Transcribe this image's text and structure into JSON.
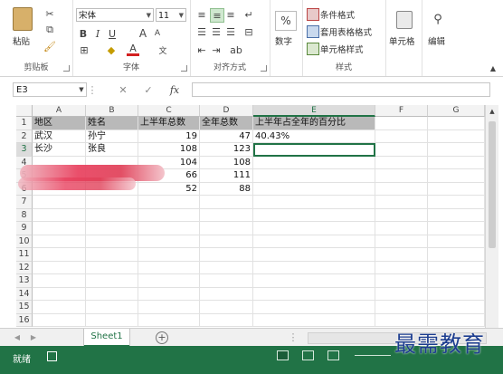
{
  "ribbon": {
    "clipboard": {
      "paste_label": "粘贴",
      "group_label": "剪贴板"
    },
    "font": {
      "name": "宋体",
      "size": "11",
      "bold": "B",
      "italic": "I",
      "underline": "U",
      "grow": "A",
      "shrink": "A",
      "font_color_glyph": "A",
      "group_label": "字体"
    },
    "alignment": {
      "group_label": "对齐方式"
    },
    "number": {
      "percent": "%",
      "label": "数字"
    },
    "styles": {
      "conditional": "条件格式",
      "table": "套用表格格式",
      "cell_styles": "单元格样式",
      "group_label": "样式"
    },
    "cells": {
      "label": "单元格"
    },
    "editing": {
      "label": "编辑"
    }
  },
  "formula_bar": {
    "name_box": "E3",
    "cancel": "✕",
    "enter": "✓",
    "fx": "fx",
    "value": ""
  },
  "columns": [
    "A",
    "B",
    "C",
    "D",
    "E",
    "F",
    "G"
  ],
  "rows": [
    "1",
    "2",
    "3",
    "4",
    "5",
    "6",
    "7",
    "8",
    "9",
    "10",
    "11",
    "12",
    "13",
    "14",
    "15",
    "16"
  ],
  "table": {
    "headers": [
      "地区",
      "姓名",
      "上半年总数",
      "全年总数",
      "上半年占全年的百分比"
    ],
    "data": [
      [
        "武汉",
        "孙宁",
        "19",
        "47",
        "40.43%"
      ],
      [
        "长沙",
        "张良",
        "108",
        "123",
        ""
      ],
      [
        "",
        "",
        "104",
        "108",
        ""
      ],
      [
        "",
        "",
        "66",
        "111",
        ""
      ],
      [
        "",
        "",
        "52",
        "88",
        ""
      ]
    ]
  },
  "active_cell": "E3",
  "sheet_tab": "Sheet1",
  "status": {
    "ready": "就绪"
  },
  "watermark": "最需教育",
  "colors": {
    "accent": "#217346",
    "header_fill": "#b9b9b9",
    "redaction": "#e0405a"
  }
}
